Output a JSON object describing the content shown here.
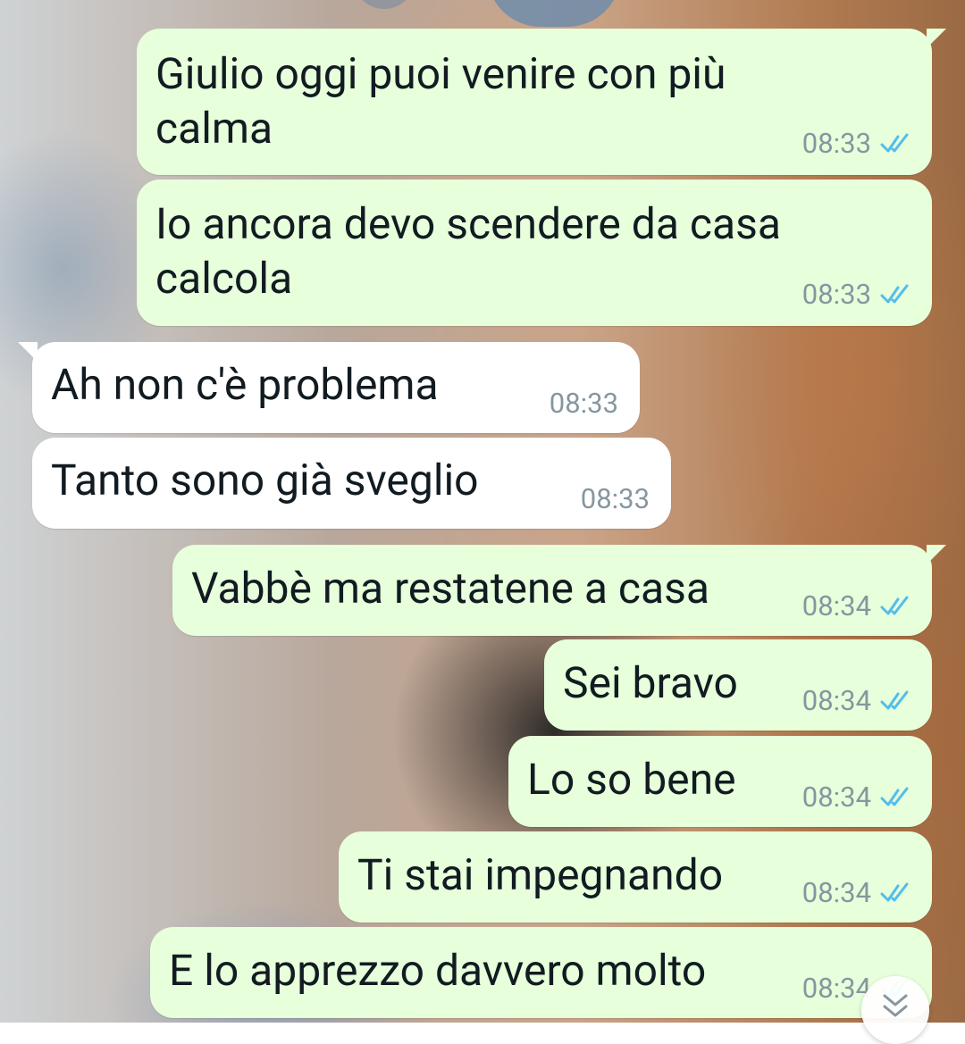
{
  "messages": [
    {
      "direction": "outgoing",
      "lines": [
        "Giulio oggi puoi venire con più",
        "calma"
      ],
      "time": "08:33",
      "status": "read"
    },
    {
      "direction": "outgoing",
      "lines": [
        "Io ancora devo scendere da casa",
        "calcola"
      ],
      "time": "08:33",
      "status": "read"
    },
    {
      "direction": "incoming",
      "lines": [
        "Ah non c'è problema"
      ],
      "time": "08:33"
    },
    {
      "direction": "incoming",
      "lines": [
        "Tanto sono già sveglio"
      ],
      "time": "08:33"
    },
    {
      "direction": "outgoing",
      "lines": [
        "Vabbè ma restatene a casa"
      ],
      "time": "08:34",
      "status": "read"
    },
    {
      "direction": "outgoing",
      "lines": [
        "Sei bravo"
      ],
      "time": "08:34",
      "status": "read"
    },
    {
      "direction": "outgoing",
      "lines": [
        "Lo so bene"
      ],
      "time": "08:34",
      "status": "read"
    },
    {
      "direction": "outgoing",
      "lines": [
        "Ti stai impegnando"
      ],
      "time": "08:34",
      "status": "read"
    },
    {
      "direction": "outgoing",
      "lines": [
        "E lo apprezzo davvero molto"
      ],
      "time": "08:34",
      "status": "read"
    }
  ],
  "colors": {
    "outgoing_bubble": "#e7ffdb",
    "incoming_bubble": "#ffffff",
    "read_ticks": "#53bdeb",
    "timestamp": "#8696a0"
  },
  "icons": {
    "read_receipt": "double-check-icon",
    "scroll_down": "chevron-double-down-icon"
  }
}
